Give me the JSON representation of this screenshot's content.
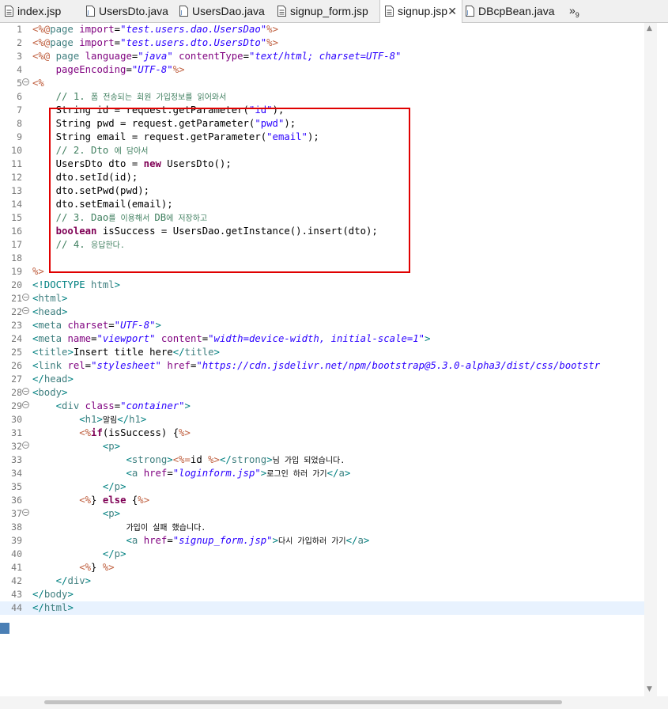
{
  "tabs": [
    {
      "label": "index.jsp",
      "active": false
    },
    {
      "label": "UsersDto.java",
      "active": false
    },
    {
      "label": "UsersDao.java",
      "active": false
    },
    {
      "label": "signup_form.jsp",
      "active": false
    },
    {
      "label": "signup.jsp",
      "active": true,
      "close": "✕"
    },
    {
      "label": "DBcpBean.java",
      "active": false
    }
  ],
  "overflow": {
    "symbol": "»",
    "count": "9"
  },
  "editor": {
    "line_numbers": [
      "1",
      "2",
      "3",
      "4",
      "5",
      "6",
      "7",
      "8",
      "9",
      "10",
      "11",
      "12",
      "13",
      "14",
      "15",
      "16",
      "17",
      "18",
      "19",
      "20",
      "21",
      "22",
      "23",
      "24",
      "25",
      "26",
      "27",
      "28",
      "29",
      "30",
      "31",
      "32",
      "33",
      "34",
      "35",
      "36",
      "37",
      "38",
      "39",
      "40",
      "41",
      "42",
      "43",
      "44"
    ],
    "current_line": "44",
    "folded_lines": [
      "5",
      "21",
      "22",
      "28",
      "29",
      "32",
      "37"
    ],
    "lines": [
      [
        [
          "jsp",
          "<%@"
        ],
        [
          "kw2",
          "page "
        ],
        [
          "attr",
          "import"
        ],
        [
          "p",
          "="
        ],
        [
          "val",
          "\"test.users.dao.UsersDao\""
        ],
        [
          "jsp",
          "%>"
        ]
      ],
      [
        [
          "jsp",
          "<%@"
        ],
        [
          "kw2",
          "page "
        ],
        [
          "attr",
          "import"
        ],
        [
          "p",
          "="
        ],
        [
          "val",
          "\"test.users.dto.UsersDto\""
        ],
        [
          "jsp",
          "%>"
        ]
      ],
      [
        [
          "jsp",
          "<%@ "
        ],
        [
          "kw2",
          "page "
        ],
        [
          "attr",
          "language"
        ],
        [
          "p",
          "="
        ],
        [
          "val",
          "\"java\""
        ],
        [
          "p",
          " "
        ],
        [
          "attr",
          "contentType"
        ],
        [
          "p",
          "="
        ],
        [
          "val",
          "\"text/html; charset=UTF-8\""
        ]
      ],
      [
        [
          "p",
          "    "
        ],
        [
          "attr",
          "pageEncoding"
        ],
        [
          "p",
          "="
        ],
        [
          "val",
          "\"UTF-8\""
        ],
        [
          "jsp",
          "%>"
        ]
      ],
      [
        [
          "jsp",
          "<%"
        ]
      ],
      [
        [
          "p",
          "    "
        ],
        [
          "com",
          "// 1. "
        ],
        [
          "comkr",
          "폼 전송되는 회원 가입정보를 읽어와서"
        ]
      ],
      [
        [
          "p",
          "    String id = request.getParameter("
        ],
        [
          "str",
          "\"id\""
        ],
        [
          "p",
          ");"
        ]
      ],
      [
        [
          "p",
          "    String pwd = request.getParameter("
        ],
        [
          "str",
          "\"pwd\""
        ],
        [
          "p",
          ");"
        ]
      ],
      [
        [
          "p",
          "    String email = request.getParameter("
        ],
        [
          "str",
          "\"email\""
        ],
        [
          "p",
          ");"
        ]
      ],
      [
        [
          "p",
          "    "
        ],
        [
          "com",
          "// 2. Dto "
        ],
        [
          "comkr",
          "에 담아서"
        ]
      ],
      [
        [
          "p",
          "    UsersDto dto = "
        ],
        [
          "kw",
          "new"
        ],
        [
          "p",
          " UsersDto();"
        ]
      ],
      [
        [
          "p",
          "    dto.setId(id);"
        ]
      ],
      [
        [
          "p",
          "    dto.setPwd(pwd);"
        ]
      ],
      [
        [
          "p",
          "    dto.setEmail(email);"
        ]
      ],
      [
        [
          "p",
          "    "
        ],
        [
          "com",
          "// 3. Dao"
        ],
        [
          "comkr",
          "를 이용해서 "
        ],
        [
          "com",
          "DB"
        ],
        [
          "comkr",
          "에 저장하고"
        ]
      ],
      [
        [
          "p",
          "    "
        ],
        [
          "kw",
          "boolean"
        ],
        [
          "p",
          " isSuccess = UsersDao.getInstance().insert(dto);"
        ]
      ],
      [
        [
          "p",
          "    "
        ],
        [
          "com",
          "// 4. "
        ],
        [
          "comkr",
          "응답한다."
        ]
      ],
      [],
      [
        [
          "jsp",
          "%>"
        ]
      ],
      [
        [
          "dt",
          "<!DOCTYPE "
        ],
        [
          "tag",
          "html"
        ],
        [
          "dt",
          ">"
        ]
      ],
      [
        [
          "dt",
          "<"
        ],
        [
          "tag",
          "html"
        ],
        [
          "dt",
          ">"
        ]
      ],
      [
        [
          "dt",
          "<"
        ],
        [
          "tag",
          "head"
        ],
        [
          "dt",
          ">"
        ]
      ],
      [
        [
          "dt",
          "<"
        ],
        [
          "tag",
          "meta "
        ],
        [
          "attr",
          "charset"
        ],
        [
          "p",
          "="
        ],
        [
          "val",
          "\"UTF-8\""
        ],
        [
          "dt",
          ">"
        ]
      ],
      [
        [
          "dt",
          "<"
        ],
        [
          "tag",
          "meta "
        ],
        [
          "attr",
          "name"
        ],
        [
          "p",
          "="
        ],
        [
          "val",
          "\"viewport\""
        ],
        [
          "p",
          " "
        ],
        [
          "attr",
          "content"
        ],
        [
          "p",
          "="
        ],
        [
          "val",
          "\"width=device-width, initial-scale=1\""
        ],
        [
          "dt",
          ">"
        ]
      ],
      [
        [
          "dt",
          "<"
        ],
        [
          "tag",
          "title"
        ],
        [
          "dt",
          ">"
        ],
        [
          "p",
          "Insert title here"
        ],
        [
          "dt",
          "</"
        ],
        [
          "tag",
          "title"
        ],
        [
          "dt",
          ">"
        ]
      ],
      [
        [
          "dt",
          "<"
        ],
        [
          "tag",
          "link "
        ],
        [
          "attr",
          "rel"
        ],
        [
          "p",
          "="
        ],
        [
          "val",
          "\"stylesheet\""
        ],
        [
          "p",
          " "
        ],
        [
          "attr",
          "href"
        ],
        [
          "p",
          "="
        ],
        [
          "val",
          "\"https://cdn.jsdelivr.net/npm/bootstrap@5.3.0-alpha3/dist/css/bootstr"
        ]
      ],
      [
        [
          "dt",
          "</"
        ],
        [
          "tag",
          "head"
        ],
        [
          "dt",
          ">"
        ]
      ],
      [
        [
          "dt",
          "<"
        ],
        [
          "tag",
          "body"
        ],
        [
          "dt",
          ">"
        ]
      ],
      [
        [
          "p",
          "    "
        ],
        [
          "dt",
          "<"
        ],
        [
          "tag",
          "div "
        ],
        [
          "attr",
          "class"
        ],
        [
          "p",
          "="
        ],
        [
          "val",
          "\"container\""
        ],
        [
          "dt",
          ">"
        ]
      ],
      [
        [
          "p",
          "        "
        ],
        [
          "dt",
          "<"
        ],
        [
          "tag",
          "h1"
        ],
        [
          "dt",
          ">"
        ],
        [
          "kr",
          "알림"
        ],
        [
          "dt",
          "</"
        ],
        [
          "tag",
          "h1"
        ],
        [
          "dt",
          ">"
        ]
      ],
      [
        [
          "p",
          "        "
        ],
        [
          "jsp",
          "<%"
        ],
        [
          "kw",
          "if"
        ],
        [
          "p",
          "(isSuccess) {"
        ],
        [
          "jsp",
          "%>"
        ]
      ],
      [
        [
          "p",
          "            "
        ],
        [
          "dt",
          "<"
        ],
        [
          "tag",
          "p"
        ],
        [
          "dt",
          ">"
        ]
      ],
      [
        [
          "p",
          "                "
        ],
        [
          "dt",
          "<"
        ],
        [
          "tag",
          "strong"
        ],
        [
          "dt",
          ">"
        ],
        [
          "jsp",
          "<%="
        ],
        [
          "p",
          "id "
        ],
        [
          "jsp",
          "%>"
        ],
        [
          "dt",
          "</"
        ],
        [
          "tag",
          "strong"
        ],
        [
          "dt",
          ">"
        ],
        [
          "kr",
          "님 가입 되었습니다."
        ]
      ],
      [
        [
          "p",
          "                "
        ],
        [
          "dt",
          "<"
        ],
        [
          "tag",
          "a "
        ],
        [
          "attr",
          "href"
        ],
        [
          "p",
          "="
        ],
        [
          "val",
          "\"loginform.jsp\""
        ],
        [
          "dt",
          ">"
        ],
        [
          "kr",
          "로그인 하러 가기"
        ],
        [
          "dt",
          "</"
        ],
        [
          "tag",
          "a"
        ],
        [
          "dt",
          ">"
        ]
      ],
      [
        [
          "p",
          "            "
        ],
        [
          "dt",
          "</"
        ],
        [
          "tag",
          "p"
        ],
        [
          "dt",
          ">"
        ]
      ],
      [
        [
          "p",
          "        "
        ],
        [
          "jsp",
          "<%"
        ],
        [
          "p",
          "} "
        ],
        [
          "kw",
          "else"
        ],
        [
          "p",
          " {"
        ],
        [
          "jsp",
          "%>"
        ]
      ],
      [
        [
          "p",
          "            "
        ],
        [
          "dt",
          "<"
        ],
        [
          "tag",
          "p"
        ],
        [
          "dt",
          ">"
        ]
      ],
      [
        [
          "p",
          "                "
        ],
        [
          "kr",
          "가입이 실패 했습니다."
        ]
      ],
      [
        [
          "p",
          "                "
        ],
        [
          "dt",
          "<"
        ],
        [
          "tag",
          "a "
        ],
        [
          "attr",
          "href"
        ],
        [
          "p",
          "="
        ],
        [
          "val",
          "\"signup_form.jsp\""
        ],
        [
          "dt",
          ">"
        ],
        [
          "kr",
          "다시 가입하러 가기"
        ],
        [
          "dt",
          "</"
        ],
        [
          "tag",
          "a"
        ],
        [
          "dt",
          ">"
        ]
      ],
      [
        [
          "p",
          "            "
        ],
        [
          "dt",
          "</"
        ],
        [
          "tag",
          "p"
        ],
        [
          "dt",
          ">"
        ]
      ],
      [
        [
          "p",
          "        "
        ],
        [
          "jsp",
          "<%"
        ],
        [
          "p",
          "} "
        ],
        [
          "jsp",
          "%>"
        ]
      ],
      [
        [
          "p",
          "    "
        ],
        [
          "dt",
          "</"
        ],
        [
          "tag",
          "div"
        ],
        [
          "dt",
          ">"
        ]
      ],
      [
        [
          "dt",
          "</"
        ],
        [
          "tag",
          "body"
        ],
        [
          "dt",
          ">"
        ]
      ],
      [
        [
          "dt",
          "</"
        ],
        [
          "tag",
          "html"
        ],
        [
          "dt",
          ">"
        ]
      ]
    ]
  },
  "colors": {
    "highlight_box": "#e00000",
    "jsp_delimiter": "#bf5f3f",
    "attribute": "#7f007f",
    "attr_value": "#2a00ff",
    "keyword": "#7f0055",
    "comment": "#3f7f5f",
    "tag_name": "#3f7f7f",
    "current_line_bg": "#e8f2fe"
  },
  "icons": {
    "jsp_file": "jsp-file-icon",
    "java_file": "java-file-icon",
    "close": "close-icon",
    "overflow": "tab-overflow-icon",
    "fold": "fold-collapse-icon"
  }
}
